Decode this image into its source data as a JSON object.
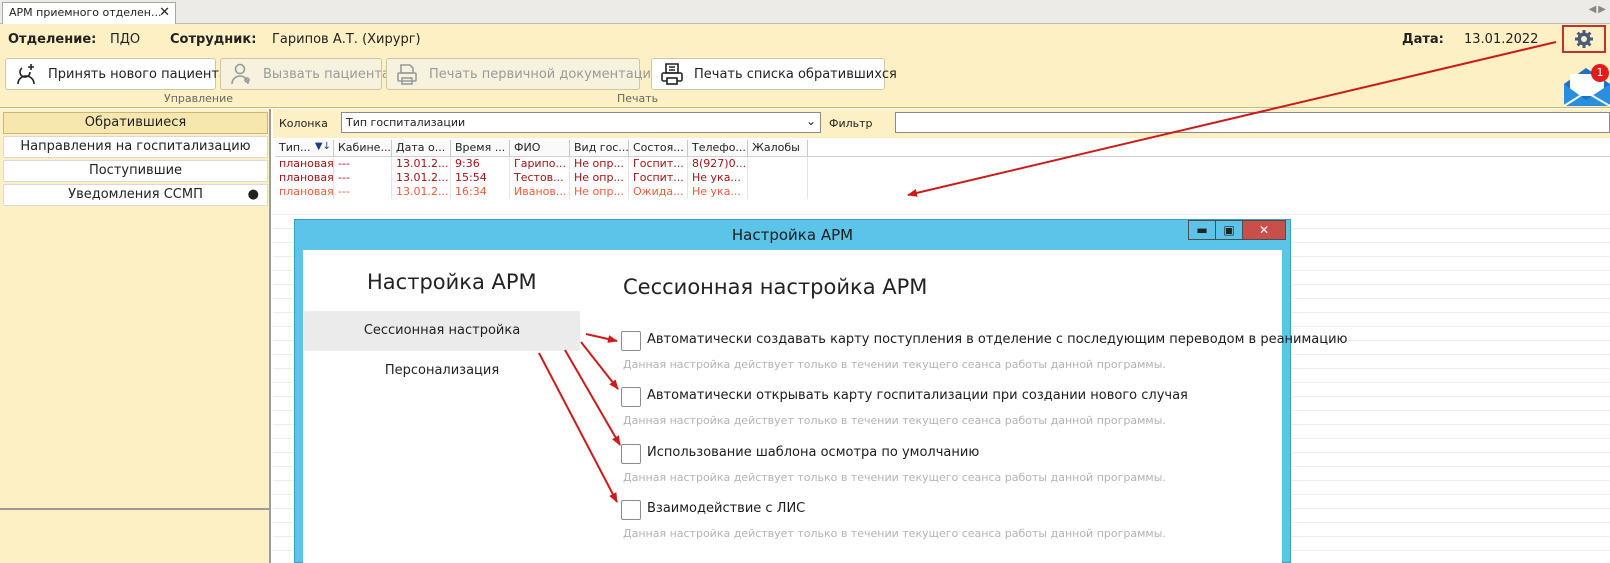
{
  "tab": {
    "title": "АРМ приемного отделен...",
    "close": "✕"
  },
  "header": {
    "department_label": "Отделение:",
    "department_value": "ПДО",
    "employee_label": "Сотрудник:",
    "employee_value": "Гарипов А.Т. (Хирург)",
    "date_label": "Дата:",
    "date_value": "13.01.2022"
  },
  "toolbar": {
    "new_patient": "Принять нового пациента",
    "call_patient": "Вызвать пациента",
    "print_primary": "Печать первичной документации",
    "print_list": "Печать списка обратившихся",
    "group_management": "Управление",
    "group_print": "Печать",
    "mail_badge": "1"
  },
  "sidebar": {
    "items": [
      {
        "label": "Обратившиеся"
      },
      {
        "label": "Направления на госпитализацию"
      },
      {
        "label": "Поступившие"
      },
      {
        "label": "Уведомления ССМП",
        "dot": "●"
      }
    ]
  },
  "filterbar": {
    "column_label": "Колонка",
    "column_value": "Тип госпитализации",
    "filter_label": "Фильтр"
  },
  "grid": {
    "columns": [
      "Тип...",
      "Кабине...",
      "Дата о...",
      "Время ...",
      "ФИО",
      "Вид гос...",
      "Состоя...",
      "Телефо...",
      "Жалобы"
    ],
    "sort_icon": "▼↓",
    "rows": [
      [
        "плановая",
        "---",
        "13.01.2...",
        "9:36",
        "Гарипо...",
        "Не опр...",
        "Госпит...",
        "8(927)0...",
        ""
      ],
      [
        "плановая",
        "---",
        "13.01.2...",
        "15:54",
        "Тестов...",
        "Не опр...",
        "Госпит...",
        "Не ука...",
        ""
      ],
      [
        "плановая",
        "---",
        "13.01.2...",
        "16:34",
        "Иванов...",
        "Не опр...",
        "Ожида...",
        "Не ука...",
        ""
      ]
    ]
  },
  "dialog": {
    "title": "Настройка АРМ",
    "minimize": "▬",
    "maximize": "▣",
    "close": "✕",
    "left_title": "Настройка АРМ",
    "menu": [
      "Сессионная настройка",
      "Персонализация"
    ],
    "right_title": "Сессионная настройка АРМ",
    "options": [
      {
        "label": "Автоматически создавать карту поступления в отделение с последующим переводом в реанимацию",
        "hint": "Данная настройка действует только в течении текущего сеанса работы данной программы.",
        "checked": false
      },
      {
        "label": "Автоматически открывать карту госпитализации при создании нового случая",
        "hint": "Данная настройка действует только в течении текущего сеанса работы данной программы.",
        "checked": false
      },
      {
        "label": "Использование шаблона осмотра по умолчанию",
        "hint": "Данная настройка действует только в течении текущего сеанса работы данной программы.",
        "checked": false
      },
      {
        "label": "Взаимодействие с ЛИС",
        "hint": "Данная настройка действует только в течении текущего сеанса работы данной программы.",
        "checked": false
      }
    ]
  },
  "colors": {
    "header_bg": "#fdf0c4",
    "dialog_frame": "#5cc4e8",
    "annotation_red": "#cc1b1b",
    "row_red": "#a31212",
    "row_light_red": "#ef5a3a"
  }
}
